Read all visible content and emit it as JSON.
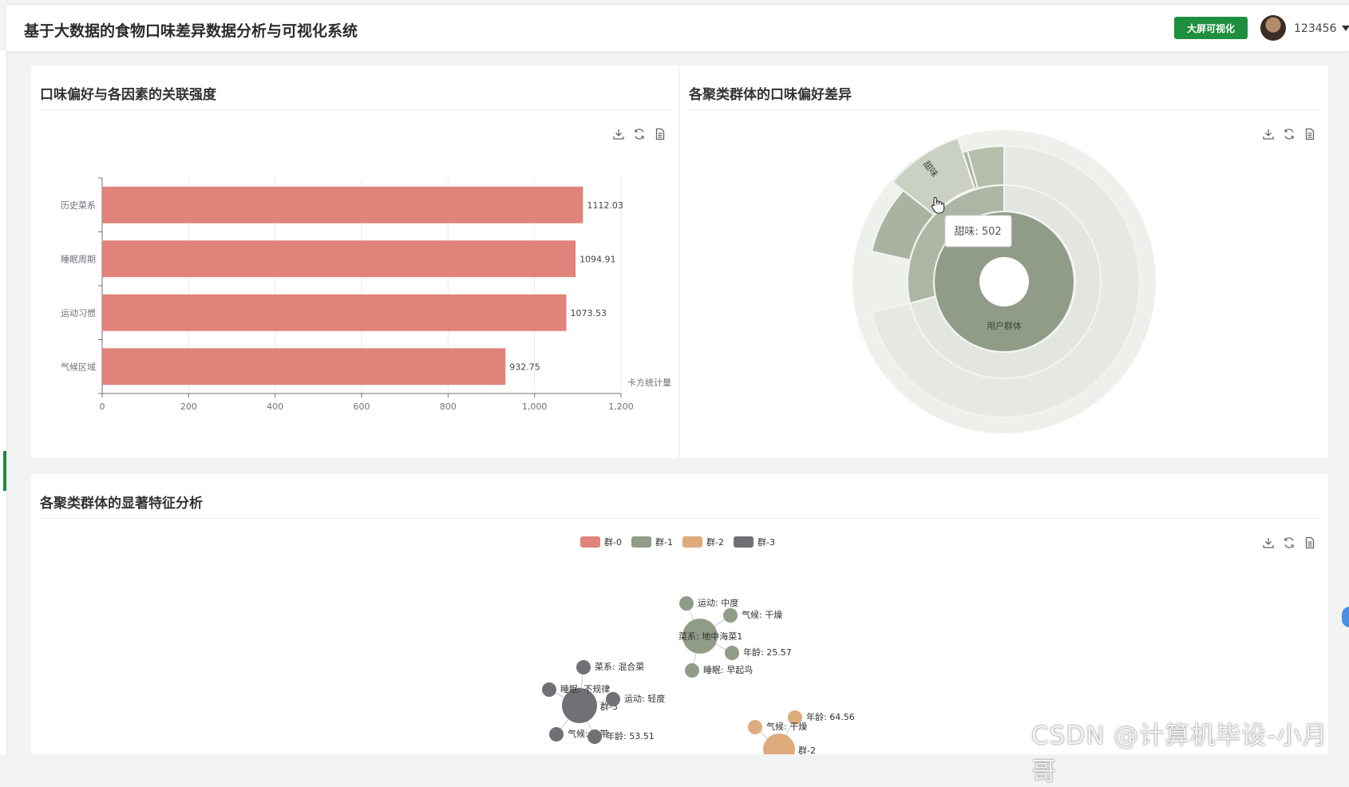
{
  "header": {
    "app_title": "基于大数据的食物口味差异数据分析与可视化系统",
    "screen_button": "大屏可视化",
    "username": "123456"
  },
  "panels": {
    "bar": {
      "title": "口味偏好与各因素的关联强度"
    },
    "sunburst": {
      "title": "各聚类群体的口味偏好差异"
    },
    "graph": {
      "title": "各聚类群体的显著特征分析"
    }
  },
  "toolbox": [
    "download-icon",
    "refresh-icon",
    "data-view-icon"
  ],
  "watermark": "CSDN @计算机毕设-小月哥",
  "chart_data": [
    {
      "type": "bar",
      "orientation": "horizontal",
      "categories": [
        "历史菜系",
        "睡眠周期",
        "运动习惯",
        "气候区域"
      ],
      "values": [
        1112.03,
        1094.91,
        1073.53,
        932.75
      ],
      "xlabel": "卡方统计量",
      "xlim": [
        0,
        1200
      ],
      "xticks": [
        "0",
        "200",
        "400",
        "600",
        "800",
        "1,000",
        "1,200"
      ],
      "color": "#e0837a",
      "grid": true
    },
    {
      "type": "sunburst",
      "root": "用户群体",
      "tooltip": "甜味: 502",
      "highlighted": [
        "甜味"
      ],
      "colors": {
        "root": "#919c88",
        "highlight_ring": "#adb6a4",
        "highlight_outer": "#c7cebf",
        "faded": "#e6e9e3"
      }
    },
    {
      "type": "graph",
      "legend": [
        "群-0",
        "群-1",
        "群-2",
        "群-3"
      ],
      "legend_colors": [
        "#e0837a",
        "#919c88",
        "#deab7c",
        "#6f7175"
      ],
      "nodes": [
        {
          "name": "菜系: 地中海菜1",
          "group": "群-1",
          "hub": true
        },
        {
          "name": "运动: 中度",
          "group": "群-1"
        },
        {
          "name": "气候: 干燥",
          "group": "群-1"
        },
        {
          "name": "年龄: 25.57",
          "group": "群-1"
        },
        {
          "name": "睡眠: 早起鸟",
          "group": "群-1"
        },
        {
          "name": "群-3",
          "group": "群-3",
          "hub": true
        },
        {
          "name": "菜系: 混合菜",
          "group": "群-3"
        },
        {
          "name": "睡眠: 不规律",
          "group": "群-3"
        },
        {
          "name": "运动: 轻度",
          "group": "群-3"
        },
        {
          "name": "气候: 热带",
          "group": "群-3"
        },
        {
          "name": "年龄: 53.51",
          "group": "群-3"
        },
        {
          "name": "群-2",
          "group": "群-2",
          "hub": true
        },
        {
          "name": "年龄: 64.56",
          "group": "群-2"
        },
        {
          "name": "气候: 干燥",
          "group": "群-2"
        }
      ]
    }
  ]
}
